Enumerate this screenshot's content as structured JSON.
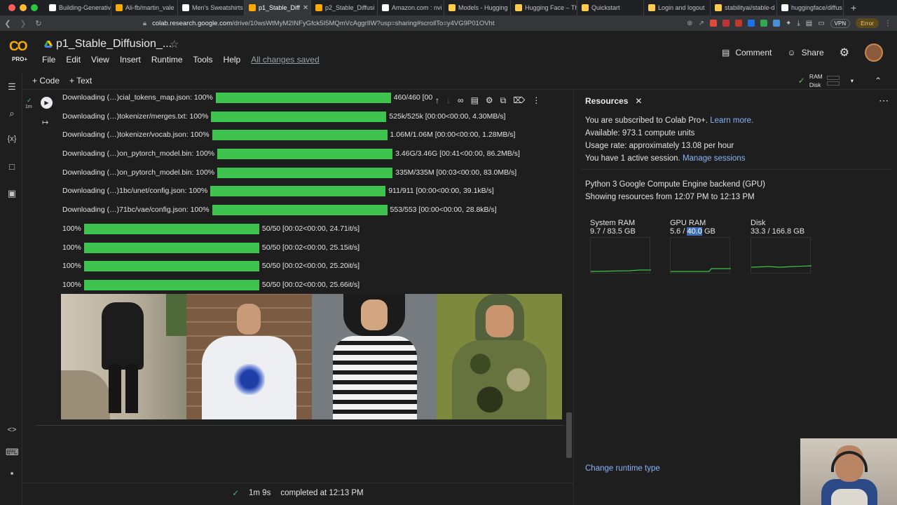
{
  "browser": {
    "tabs": [
      {
        "label": "Building-Generativ",
        "color": "#ffffff",
        "active": false
      },
      {
        "label": "Ali-fb/martin_vale",
        "color": "#f9ab00",
        "active": false
      },
      {
        "label": "Men's Sweatshirts",
        "color": "#ffffff",
        "active": false
      },
      {
        "label": "p1_Stable_Diff",
        "color": "#f9ab00",
        "active": true
      },
      {
        "label": "p2_Stable_Diffusi",
        "color": "#f9ab00",
        "active": false
      },
      {
        "label": "Amazon.com : nvi",
        "color": "#ffffff",
        "active": false
      },
      {
        "label": "Models - Hugging",
        "color": "#ffcc4d",
        "active": false
      },
      {
        "label": "Hugging Face – Th",
        "color": "#ffcc4d",
        "active": false
      },
      {
        "label": "Quickstart",
        "color": "#ffcc4d",
        "active": false
      },
      {
        "label": "Login and logout",
        "color": "#ffcc4d",
        "active": false
      },
      {
        "label": "stabilityai/stable-d",
        "color": "#ffcc4d",
        "active": false
      },
      {
        "label": "huggingface/diffus",
        "color": "#ffffff",
        "active": false
      }
    ],
    "url_host": "colab.research.google.com",
    "url_path": "/drive/10wsWtMyM2INFyGfck5I5MQmVcAggrlIW?usp=sharing#scrollTo=y4VG9P01OVht",
    "vpn_label": "VPN",
    "error_label": "Error"
  },
  "header": {
    "logo_text": "CO",
    "logo_badge": "PRO+",
    "notebook_title": "p1_Stable_Diffusion_...",
    "menus": [
      "File",
      "Edit",
      "View",
      "Insert",
      "Runtime",
      "Tools",
      "Help"
    ],
    "saved_status": "All changes saved",
    "comment_label": "Comment",
    "share_label": "Share"
  },
  "toolbar": {
    "add_code": "+ Code",
    "add_text": "+ Text",
    "ram_label": "RAM",
    "disk_label": "Disk"
  },
  "cell": {
    "exec_time": "1m",
    "progress_rows": [
      {
        "prefix": "Downloading (…)cial_tokens_map.json: 100%",
        "suffix": "460/460 [00:00<00:00, 3.14MB/s]",
        "fill": 1.0
      },
      {
        "prefix": "Downloading (…)tokenizer/merges.txt: 100%",
        "suffix": "525k/525k [00:00<00:00, 4.30MB/s]",
        "fill": 1.0
      },
      {
        "prefix": "Downloading (…)tokenizer/vocab.json: 100%",
        "suffix": "1.06M/1.06M [00:00<00:00, 1.28MB/s]",
        "fill": 1.0
      },
      {
        "prefix": "Downloading (…)on_pytorch_model.bin: 100%",
        "suffix": "3.46G/3.46G [00:41<00:00, 86.2MB/s]",
        "fill": 1.0
      },
      {
        "prefix": "Downloading (…)on_pytorch_model.bin: 100%",
        "suffix": "335M/335M [00:03<00:00, 83.0MB/s]",
        "fill": 1.0
      },
      {
        "prefix": "Downloading (…)1bc/unet/config.json: 100%",
        "suffix": "911/911 [00:00<00:00, 39.1kB/s]",
        "fill": 1.0
      },
      {
        "prefix": "Downloading (…)71bc/vae/config.json: 100%",
        "suffix": "553/553 [00:00<00:00, 28.8kB/s]",
        "fill": 1.0
      },
      {
        "prefix": "100%",
        "suffix": "50/50 [00:02<00:00, 24.71it/s]",
        "fill": 1.0
      },
      {
        "prefix": "100%",
        "suffix": "50/50 [00:02<00:00, 25.15it/s]",
        "fill": 1.0
      },
      {
        "prefix": "100%",
        "suffix": "50/50 [00:02<00:00, 25.20it/s]",
        "fill": 1.0
      },
      {
        "prefix": "100%",
        "suffix": "50/50 [00:02<00:00, 25.66it/s]",
        "fill": 1.0
      }
    ]
  },
  "resources": {
    "title": "Resources",
    "sub_text": "You are subscribed to Colab Pro+.",
    "learn_more": "Learn more.",
    "available": "Available: 973.1 compute units",
    "usage_rate": "Usage rate: approximately 13.08 per hour",
    "sessions_text": "You have 1 active session.",
    "manage_sessions": "Manage sessions",
    "backend": "Python 3 Google Compute Engine backend (GPU)",
    "showing": "Showing resources from 12:07 PM to 12:13 PM",
    "gauges": [
      {
        "label": "System RAM",
        "value": "9.7 / 83.5 GB",
        "level": 0.116
      },
      {
        "label": "GPU RAM",
        "value_pre": "5.6 / ",
        "value_hl": "40.0",
        "value_post": " GB",
        "level": 0.14
      },
      {
        "label": "Disk",
        "value": "33.3 / 166.8 GB",
        "level": 0.2
      }
    ],
    "change_runtime": "Change runtime type"
  },
  "status": {
    "duration": "1m 9s",
    "completed": "completed at 12:13 PM"
  },
  "colors": {
    "progress_green": "#3ec34e",
    "link_blue": "#8ab4f8",
    "colab_orange": "#f9ab00"
  }
}
